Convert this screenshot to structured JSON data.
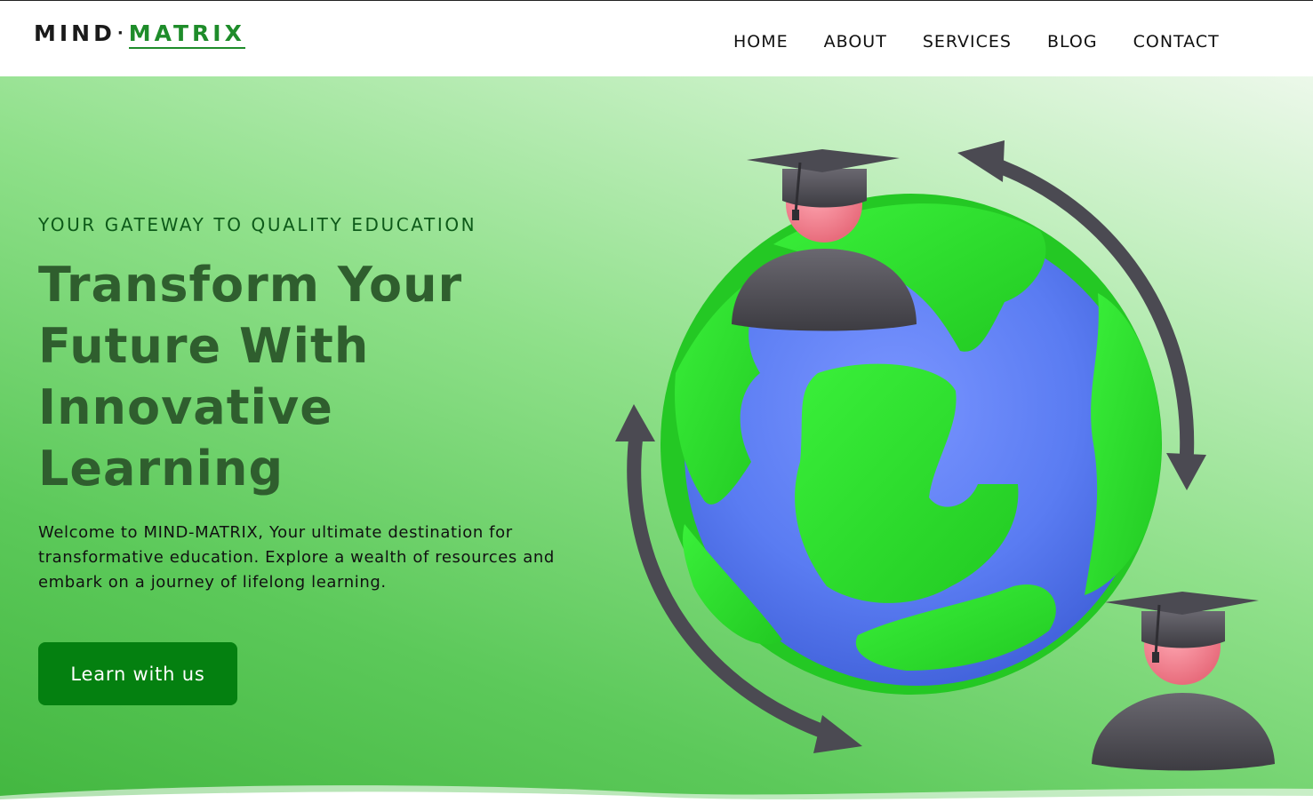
{
  "brand": {
    "name_part1": "MIND",
    "separator": "·",
    "name_part2": "MATRIX"
  },
  "nav": {
    "items": [
      "HOME",
      "ABOUT",
      "SERVICES",
      "BLOG",
      "CONTACT"
    ]
  },
  "hero": {
    "eyebrow": "YOUR GATEWAY TO QUALITY EDUCATION",
    "headline_lines": [
      "Transform Your",
      "Future With",
      "Innovative",
      "Learning"
    ],
    "intro_lines": [
      "Welcome to MIND-MATRIX, Your ultimate destination for",
      "transformative education. Explore a wealth of resources and",
      "embark on a journey of lifelong learning."
    ],
    "cta_label": "Learn with us",
    "illustration": "globe-with-graduates-and-cycle-arrows"
  },
  "colors": {
    "brand_green": "#1e8c2a",
    "cta_green": "#048010",
    "headline": "#2f5e2e",
    "eyebrow": "#0d5a19"
  }
}
